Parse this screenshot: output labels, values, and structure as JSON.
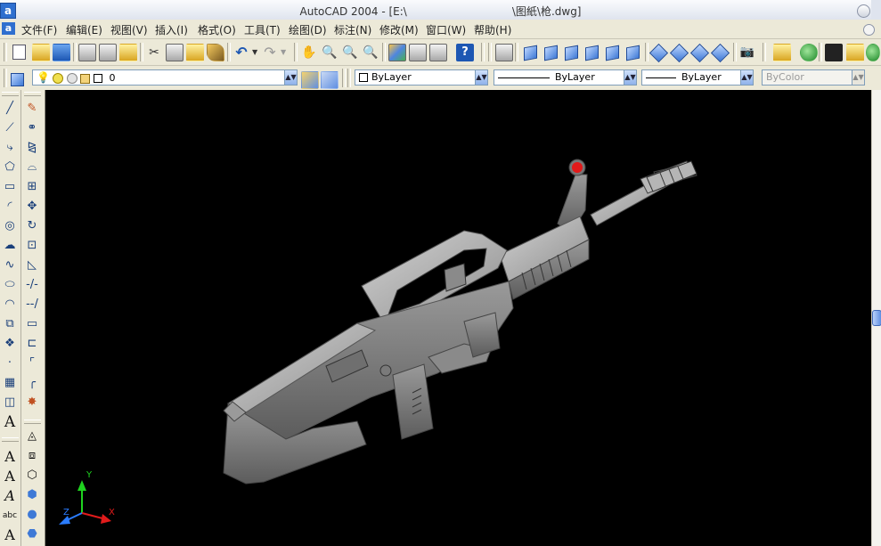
{
  "window": {
    "title_app": "AutoCAD 2004 - [E:\\",
    "title_file": "\\图紙\\枪.dwg]",
    "app_icon_letter": "a"
  },
  "menubar": {
    "items": [
      "文件(F)",
      "编辑(E)",
      "视图(V)",
      "插入(I)",
      "格式(O)",
      "工具(T)",
      "绘图(D)",
      "标注(N)",
      "修改(M)",
      "窗口(W)",
      "帮助(H)"
    ]
  },
  "properties": {
    "layer_value": "0",
    "color_value": "ByLayer",
    "linetype_value": "ByLayer",
    "lineweight_value": "ByLayer",
    "plotstyle_value": "ByColor"
  },
  "draw_toolbar": {
    "text_tool_label": "A"
  },
  "modify_toolbar": {},
  "ucs": {
    "x_label": "X",
    "y_label": "Y",
    "z_label": "Z",
    "x_color": "#e11b1b",
    "y_color": "#1fd31f",
    "z_color": "#2a7cff"
  },
  "canvas": {
    "background": "#000000",
    "model_color": "#8a8a8a",
    "sight_dot_color": "#e21a1a"
  }
}
